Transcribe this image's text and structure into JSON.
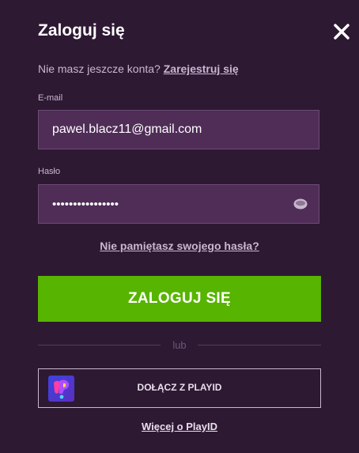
{
  "dialog": {
    "title": "Zaloguj się",
    "close_icon": "close-icon"
  },
  "signup": {
    "prompt": "Nie masz jeszcze konta?",
    "link": "Zarejestruj się"
  },
  "email": {
    "label": "E-mail",
    "value": "pawel.blacz11@gmail.com"
  },
  "password": {
    "label": "Hasło",
    "value": "••••••••••••••••",
    "toggle_icon": "eye-icon"
  },
  "forgot_password": "Nie pamiętasz swojego hasła?",
  "login_button": "ZALOGUJ SIĘ",
  "divider_text": "lub",
  "playid": {
    "button_label": "DOŁĄCZ Z PLAYID",
    "logo_icon": "playid-logo-icon",
    "more_link": "Więcej o PlayID"
  },
  "colors": {
    "background": "#2e1933",
    "field_background": "#4f2d57",
    "accent_green": "#57b400",
    "muted_text": "#c9b6cf"
  }
}
